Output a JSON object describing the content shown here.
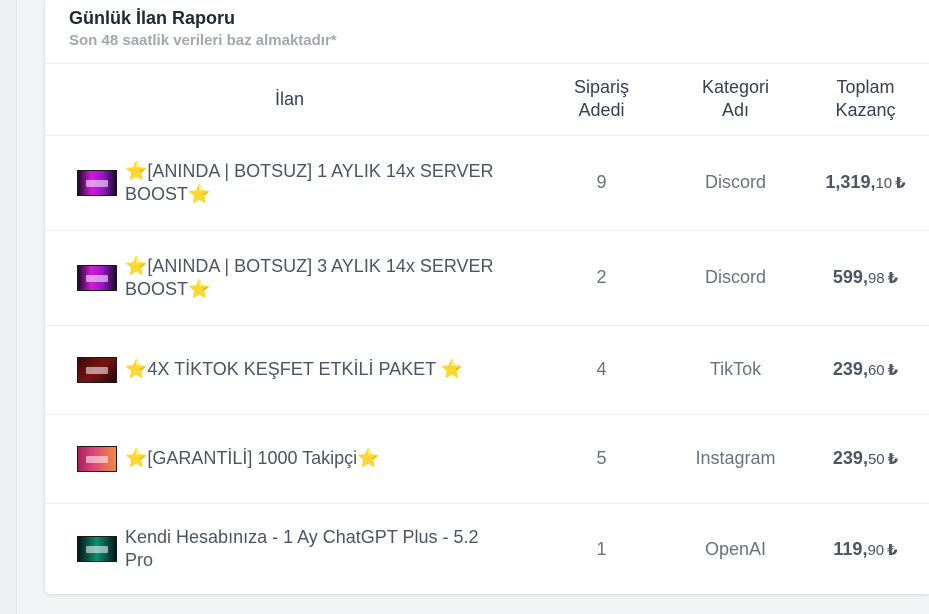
{
  "report": {
    "title": "Günlük İlan Raporu",
    "subtitle": "Son 48 saatlik verileri baz almaktadır*"
  },
  "table": {
    "headers": {
      "listing": "İlan",
      "order_count_l1": "Sipariş",
      "order_count_l2": "Adedi",
      "category_l1": "Kategori",
      "category_l2": "Adı",
      "earnings_l1": "Toplam",
      "earnings_l2": "Kazanç"
    },
    "rows": [
      {
        "title": "⭐[ANINDA | BOTSUZ] 1 AYLIK 14x SERVER BOOST⭐",
        "orders": "9",
        "category": "Discord",
        "amount_int": "1,319,",
        "amount_dec": "10",
        "currency": "₺",
        "thumb_icon": "discord-boost-thumbnail"
      },
      {
        "title": "⭐[ANINDA | BOTSUZ] 3 AYLIK 14x SERVER BOOST⭐",
        "orders": "2",
        "category": "Discord",
        "amount_int": "599,",
        "amount_dec": "98",
        "currency": "₺",
        "thumb_icon": "discord-boost-thumbnail"
      },
      {
        "title": "⭐4X TİKTOK KEŞFET ETKİLİ PAKET ⭐",
        "orders": "4",
        "category": "TikTok",
        "amount_int": "239,",
        "amount_dec": "60",
        "currency": "₺",
        "thumb_icon": "tiktok-package-thumbnail"
      },
      {
        "title": "⭐[GARANTİLİ] 1000 Takipçi⭐",
        "orders": "5",
        "category": "Instagram",
        "amount_int": "239,",
        "amount_dec": "50",
        "currency": "₺",
        "thumb_icon": "instagram-followers-thumbnail"
      },
      {
        "title": "Kendi Hesabınıza - 1 Ay ChatGPT Plus - 5.2 Pro",
        "orders": "1",
        "category": "OpenAI",
        "amount_int": "119,",
        "amount_dec": "90",
        "currency": "₺",
        "thumb_icon": "chatgpt-plus-thumbnail"
      }
    ]
  }
}
